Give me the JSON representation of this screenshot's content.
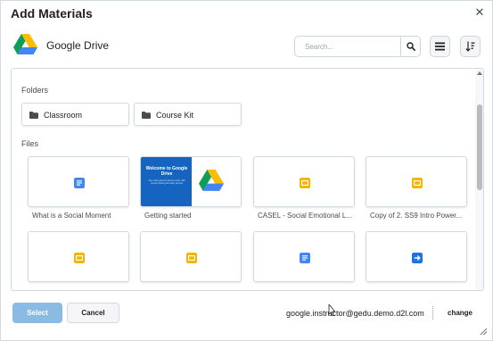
{
  "dialog": {
    "title": "Add Materials",
    "close_glyph": "✕"
  },
  "provider": {
    "name": "Google Drive",
    "icon": "google-drive-logo"
  },
  "search": {
    "placeholder": "Search...",
    "value": ""
  },
  "toolbar": {
    "search_icon": "search-icon",
    "view_icon": "list-view-icon",
    "sort_icon": "sort-icon"
  },
  "browser": {
    "folders_label": "Folders",
    "files_label": "Files",
    "folders": [
      {
        "label": "Classroom",
        "icon": "folder-icon"
      },
      {
        "label": "Course Kit",
        "icon": "folder-icon"
      }
    ],
    "files": [
      {
        "label": "What is a Social Moment",
        "icon": "google-docs-icon"
      },
      {
        "label": "Getting started",
        "icon": "getting-started-thumbnail"
      },
      {
        "label": "CASEL - Social Emotional L...",
        "icon": "google-slides-icon"
      },
      {
        "label": "Copy of 2. SS9 Intro Power...",
        "icon": "google-slides-icon"
      },
      {
        "label": "",
        "icon": "google-slides-icon"
      },
      {
        "label": "",
        "icon": "google-slides-icon"
      },
      {
        "label": "",
        "icon": "google-docs-icon"
      },
      {
        "label": "",
        "icon": "google-link-icon"
      }
    ],
    "thumbnail_text": {
      "title": "Welcome to Google Drive",
      "body": "Your safe place for all your work, with secure sharing and easy access"
    }
  },
  "footer": {
    "select_label": "Select",
    "cancel_label": "Cancel",
    "account": "google.instructor@gedu.demo.d2l.com",
    "change_label": "change"
  },
  "colors": {
    "primary_disabled": "#8bbbe3",
    "docs_blue": "#4285f4",
    "slides_yellow": "#f4b400",
    "drive_green": "#0f9d58",
    "thumbnail_blue": "#1565c0"
  }
}
